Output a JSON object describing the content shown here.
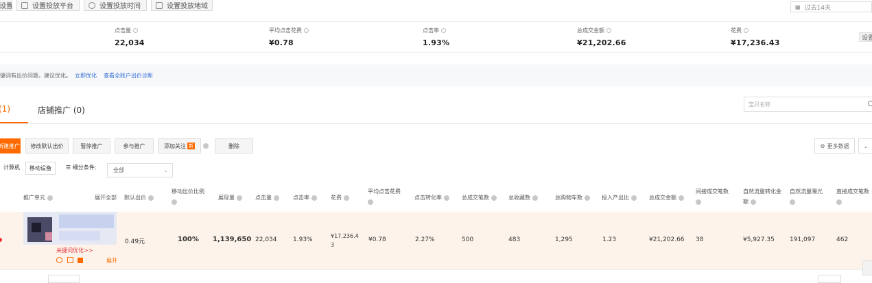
{
  "toolbar": {
    "btn0": "设置",
    "btn1": "设置投放平台",
    "btn2": "设置投放时间",
    "btn3": "设置投放地域",
    "date_range": "过去14天"
  },
  "stats": [
    {
      "label": "点击量",
      "value": "22,034"
    },
    {
      "label": "平均点击花费",
      "value": "¥0.78"
    },
    {
      "label": "点击率",
      "value": "1.93%"
    },
    {
      "label": "总成交金额",
      "value": "¥21,202.66"
    },
    {
      "label": "花费",
      "value": "¥17,236.43"
    }
  ],
  "settings_label": "设置",
  "notice": {
    "text": "键词有出价问题，建议优化。",
    "link1": "立即优化",
    "link2": "查看全账户出价诊断"
  },
  "tabs": {
    "tab1": "(1)",
    "tab2": "店铺推广 (0)"
  },
  "search_placeholder": "宝贝名称",
  "actions": {
    "new_promo": "新建推广",
    "edit_bid": "修改默认出价",
    "pause": "暂停推广",
    "join": "参与推广",
    "add_watch": "添加关注",
    "new_badge": "新",
    "delete": "删除",
    "more_data": "更多数据"
  },
  "filters": {
    "computer": "计算机",
    "mobile": "移动设备",
    "segment_label": "细分条件:",
    "segment_value": "全部"
  },
  "table": {
    "headers": {
      "unit": "推广单元",
      "expand_all": "展开全部",
      "default_bid": "默认出价",
      "mobile_ratio": "移动出价比例",
      "impressions": "展现量",
      "clicks": "点击量",
      "ctr": "点击率",
      "cost": "花费",
      "avg_cpc": "平均点击花费",
      "cvr": "点击转化率",
      "total_orders": "总成交笔数",
      "favorites": "总收藏数",
      "carts": "总购物车数",
      "roi": "投入产出比",
      "total_gmv": "总成交金额",
      "indirect_orders": "间接成交笔数",
      "natural_gmv": "自然流量转化金额",
      "natural_impr": "自然流量曝光",
      "direct_orders": "直接成交笔数"
    },
    "row": {
      "keyword_link": "关键词优化>>",
      "expand": "展开",
      "default_bid": "0.49元",
      "mobile_ratio": "100%",
      "impressions": "1,139,650",
      "clicks": "22,034",
      "ctr": "1.93%",
      "cost": "¥17,236.43",
      "avg_cpc": "¥0.78",
      "cvr": "2.27%",
      "total_orders": "500",
      "favorites": "483",
      "carts": "1,295",
      "roi": "1.23",
      "total_gmv": "¥21,202.66",
      "indirect_orders": "38",
      "natural_gmv": "¥5,927.35",
      "natural_impr": "191,097",
      "direct_orders": "462"
    }
  },
  "colors": {
    "accent": "#ff6a00",
    "link": "#2d6bd4",
    "row_bg": "#fdf3ea"
  }
}
